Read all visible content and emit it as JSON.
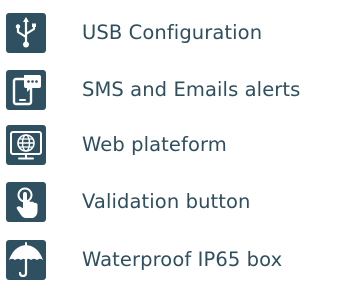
{
  "features": [
    {
      "label": "USB Configuration",
      "icon": "usb-icon"
    },
    {
      "label": "SMS and Emails alerts",
      "icon": "phone-message-icon"
    },
    {
      "label": "Web plateform",
      "icon": "web-globe-icon"
    },
    {
      "label": "Validation button",
      "icon": "touch-button-icon"
    },
    {
      "label": "Waterproof IP65 box",
      "icon": "umbrella-icon"
    }
  ],
  "colors": {
    "icon_background": "#2f5060",
    "label_text": "#2f4f5e"
  }
}
